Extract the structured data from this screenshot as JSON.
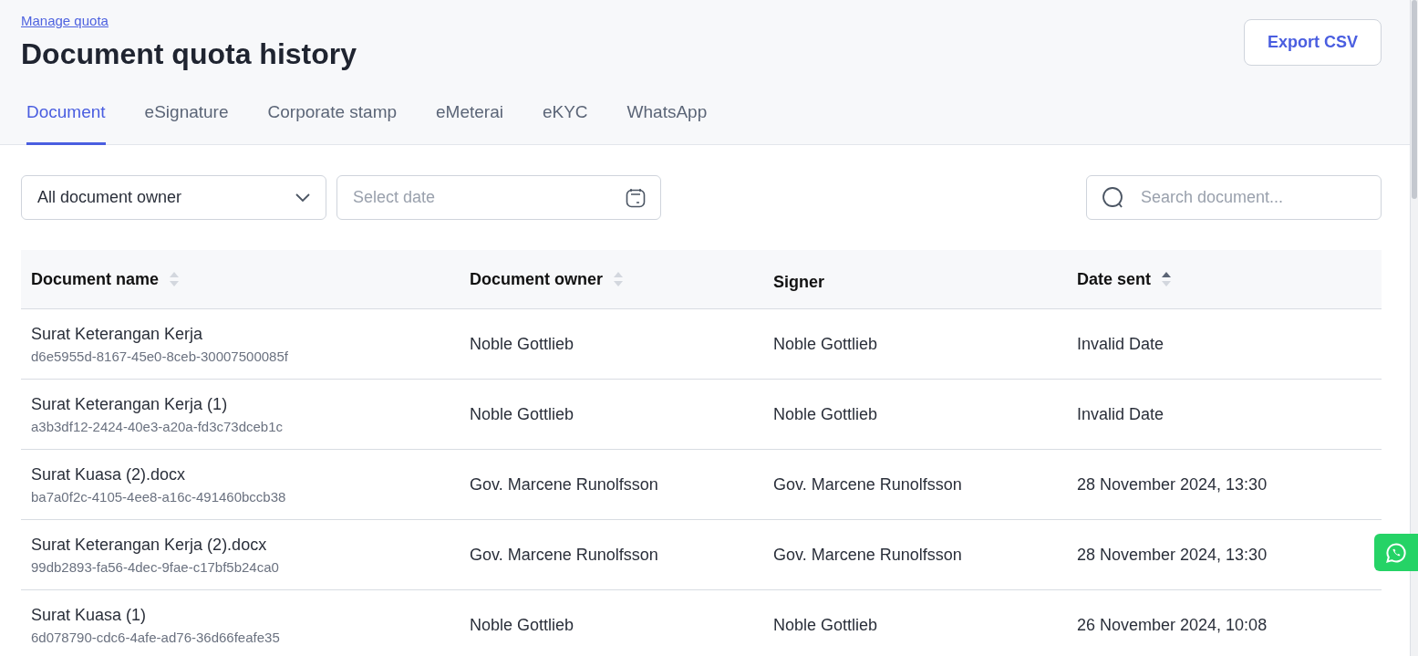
{
  "breadcrumb": "Manage quota",
  "title": "Document quota history",
  "export_button": "Export CSV",
  "tabs": [
    {
      "label": "Document",
      "selected": true
    },
    {
      "label": "eSignature",
      "selected": false
    },
    {
      "label": "Corporate stamp",
      "selected": false
    },
    {
      "label": "eMeterai",
      "selected": false
    },
    {
      "label": "eKYC",
      "selected": false
    },
    {
      "label": "WhatsApp",
      "selected": false
    }
  ],
  "filters": {
    "owner_select": "All document owner",
    "date": {
      "placeholder": "Select date"
    },
    "search": {
      "placeholder": "Search document..."
    }
  },
  "table": {
    "columns": [
      {
        "label": "Document name",
        "sortable": true,
        "sorted_ascending": false
      },
      {
        "label": "Document owner",
        "sortable": true,
        "sorted_ascending": false
      },
      {
        "label": "Signer",
        "sortable": false
      },
      {
        "label": "Date sent",
        "sortable": true,
        "sorted_ascending": true
      }
    ],
    "rows": [
      {
        "name": "Surat Keterangan Kerja",
        "id": "d6e5955d-8167-45e0-8ceb-30007500085f",
        "owner": "Noble Gottlieb",
        "signer": "Noble Gottlieb",
        "date": "Invalid Date"
      },
      {
        "name": "Surat Keterangan Kerja (1)",
        "id": "a3b3df12-2424-40e3-a20a-fd3c73dceb1c",
        "owner": "Noble Gottlieb",
        "signer": "Noble Gottlieb",
        "date": "Invalid Date"
      },
      {
        "name": "Surat Kuasa (2).docx",
        "id": "ba7a0f2c-4105-4ee8-a16c-491460bccb38",
        "owner": "Gov. Marcene Runolfsson",
        "signer": "Gov. Marcene Runolfsson",
        "date": "28 November 2024, 13:30"
      },
      {
        "name": "Surat Keterangan Kerja (2).docx",
        "id": "99db2893-fa56-4dec-9fae-c17bf5b24ca0",
        "owner": "Gov. Marcene Runolfsson",
        "signer": "Gov. Marcene Runolfsson",
        "date": "28 November 2024, 13:30"
      },
      {
        "name": "Surat Kuasa (1)",
        "id": "6d078790-cdc6-4afe-ad76-36d66feafe35",
        "owner": "Noble Gottlieb",
        "signer": "Noble Gottlieb",
        "date": "26 November 2024, 10:08"
      }
    ]
  }
}
